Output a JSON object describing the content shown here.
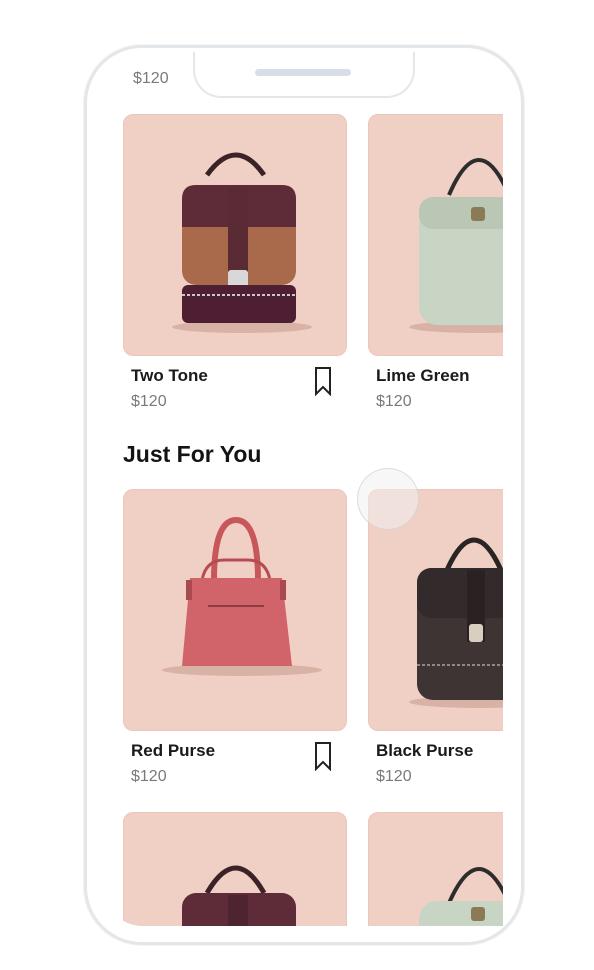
{
  "top_row": {
    "prev_price": "$120",
    "items": [
      {
        "name": "Two Tone",
        "price": "$120",
        "bookmark_icon": "bookmark-outline-icon"
      },
      {
        "name": "Lime Green",
        "price": "$120"
      }
    ]
  },
  "just_for_you": {
    "title": "Just For You",
    "items": [
      {
        "name": "Red Purse",
        "price": "$120",
        "bookmark_icon": "bookmark-outline-icon"
      },
      {
        "name": "Black Purse",
        "price": "$120"
      }
    ]
  },
  "colors": {
    "card_background": "#f0cfc4",
    "text_primary": "#1a1a1a",
    "text_secondary": "#7a7a7a"
  }
}
